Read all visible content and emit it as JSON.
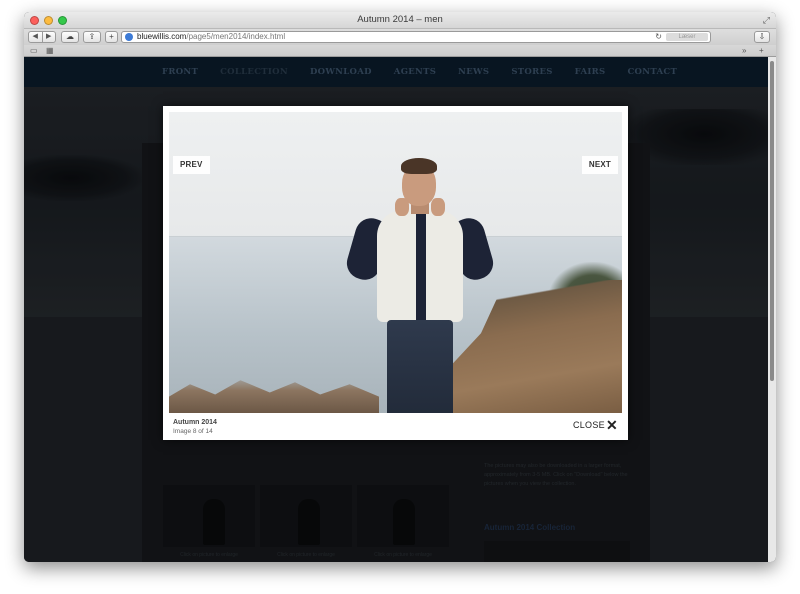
{
  "window": {
    "title": "Autumn 2014 – men",
    "url_host": "bluewillis.com",
    "url_path": "/page5/men2014/index.html",
    "reader_label": "Læser"
  },
  "site_nav": {
    "items": [
      "FRONT",
      "COLLECTION",
      "DOWNLOAD",
      "AGENTS",
      "NEWS",
      "STORES",
      "FAIRS",
      "CONTACT"
    ]
  },
  "lightbox": {
    "prev_label": "PREV",
    "next_label": "NEXT",
    "title": "Autumn 2014",
    "counter": "Image 8 of 14",
    "close_label": "CLOSE"
  },
  "background_page": {
    "download_note": "The pictures may also be downloaded in a larger format, approximately from 3-5 MB. Click on \"Download\" below the pictures when you view the collection.",
    "side_title": "Autumn 2014 Collection",
    "thumb_captions": [
      "Click on picture to enlarge",
      "Click on picture to enlarge",
      "Click on picture to enlarge"
    ]
  },
  "colors": {
    "nav_bg": "#0b1c2b",
    "overlay": "rgba(0,0,0,0.22)",
    "jacket": "#ecebe5",
    "trim": "#1d2336"
  },
  "icons": {
    "back": "back-arrow-icon",
    "forward": "forward-arrow-icon",
    "cloud": "icloud-icon",
    "share": "share-icon",
    "add": "plus-icon",
    "reload": "reload-icon",
    "download": "download-icon",
    "bookmarks": "book-icon",
    "top_sites": "grid-icon",
    "close": "close-x-icon"
  }
}
